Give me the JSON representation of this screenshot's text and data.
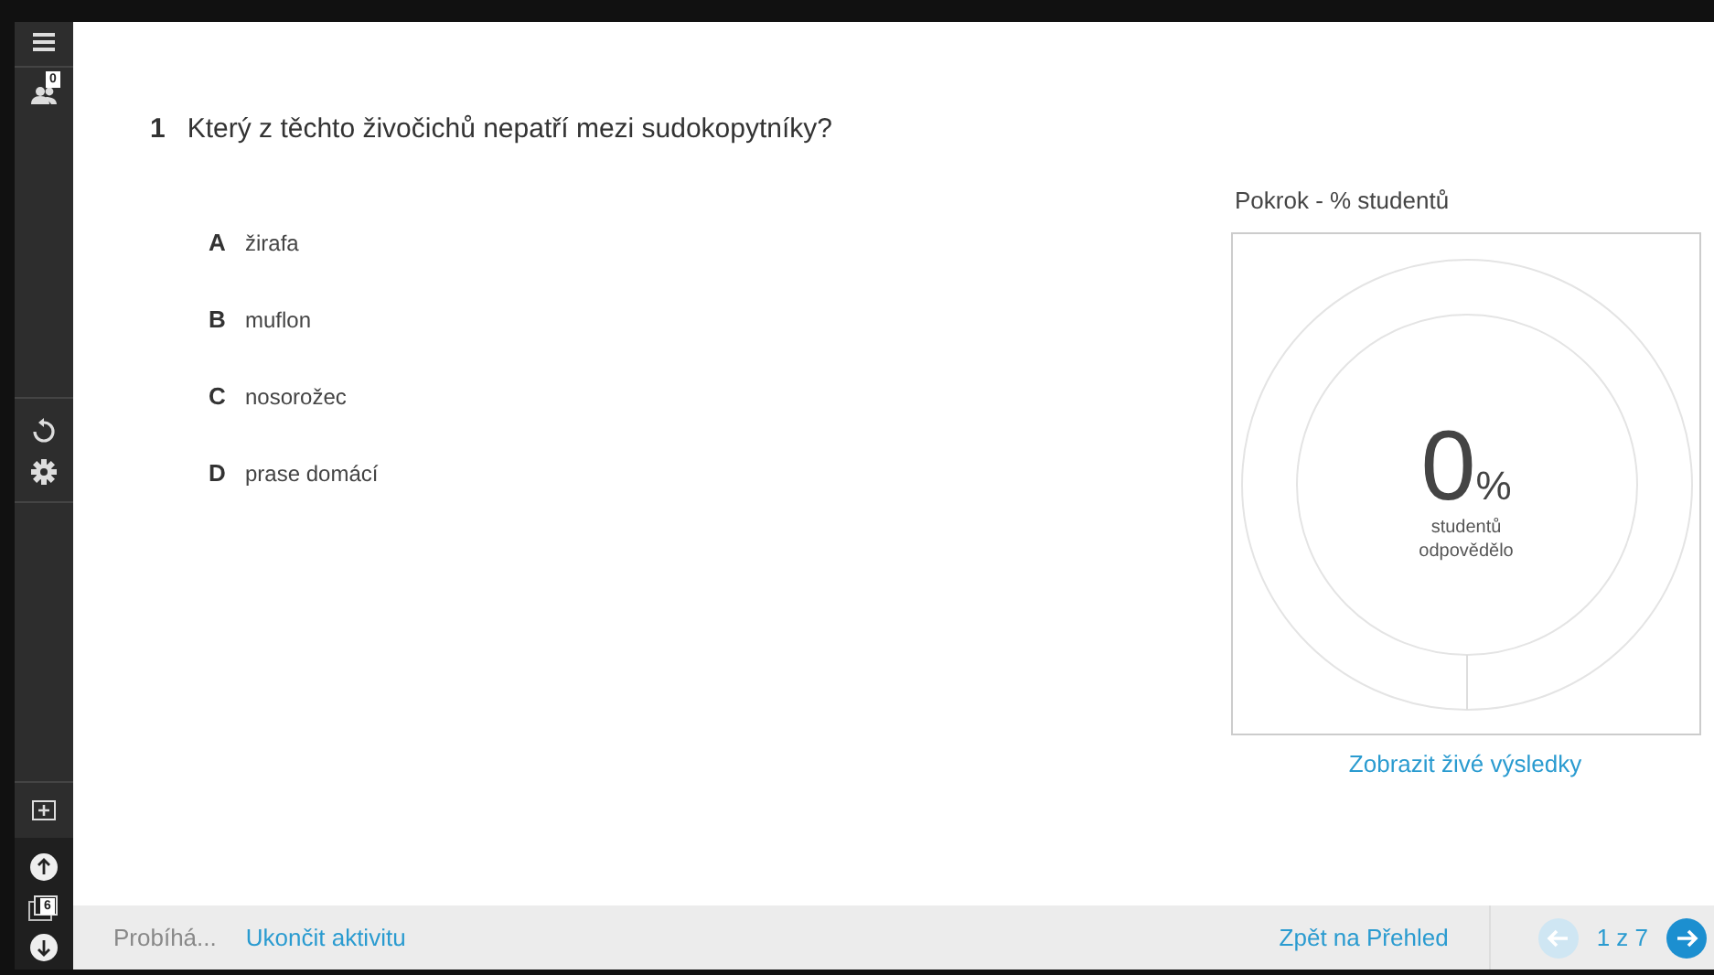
{
  "sidebar": {
    "participants_badge": "0",
    "slides_badge": "6"
  },
  "question": {
    "number": "1",
    "text": "Který z těchto živočichů nepatří mezi sudokopytníky?"
  },
  "answers": [
    {
      "letter": "A",
      "text": "žirafa"
    },
    {
      "letter": "B",
      "text": "muflon"
    },
    {
      "letter": "C",
      "text": "nosorožec"
    },
    {
      "letter": "D",
      "text": "prase domácí"
    }
  ],
  "progress": {
    "title": "Pokrok - % studentů",
    "value": "0",
    "unit": "%",
    "caption_1": "studentů",
    "caption_2": "odpovědělo",
    "link": "Zobrazit živé výsledky"
  },
  "footer": {
    "status": "Probíhá...",
    "end_link": "Ukončit aktivitu",
    "back_link": "Zpět na Přehled",
    "prev_disabled": true,
    "next_disabled": false,
    "pager": "1 z 7"
  }
}
